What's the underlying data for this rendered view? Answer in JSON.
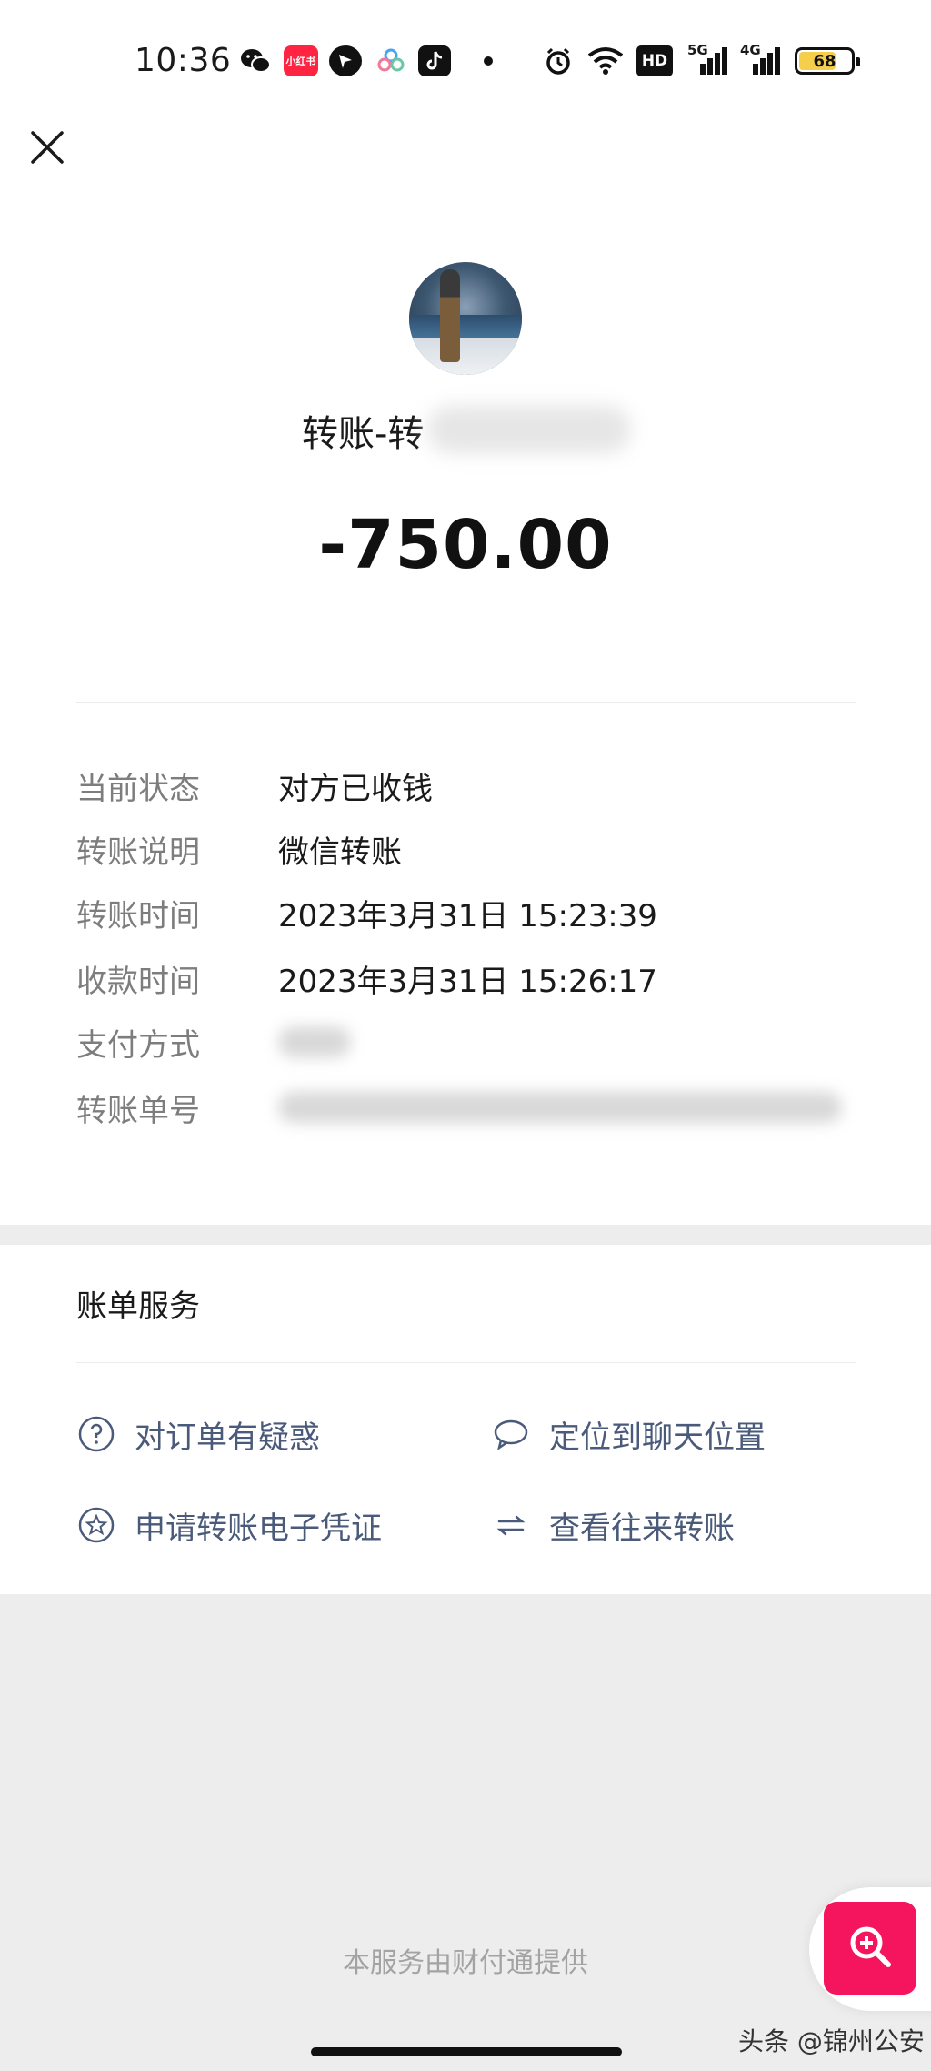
{
  "status_bar": {
    "time": "10:36",
    "app_xhs": "小红书",
    "hd": "HD",
    "signal_5g": "5G",
    "signal_4g": "4G",
    "battery": "68"
  },
  "header": {
    "title": "转账-转",
    "amount": "-750.00"
  },
  "details": {
    "status": {
      "label": "当前状态",
      "value": "对方已收钱"
    },
    "note": {
      "label": "转账说明",
      "value": "微信转账"
    },
    "transfer_time": {
      "label": "转账时间",
      "value": "2023年3月31日 15:23:39"
    },
    "receive_time": {
      "label": "收款时间",
      "value": "2023年3月31日 15:26:17"
    },
    "payment_method": {
      "label": "支付方式"
    },
    "order_number": {
      "label": "转账单号"
    }
  },
  "services": {
    "title": "账单服务",
    "question": "对订单有疑惑",
    "locate_chat": "定位到聊天位置",
    "voucher": "申请转账电子凭证",
    "history": "查看往来转账"
  },
  "footer": {
    "provider": "本服务由财付通提供",
    "watermark": "头条 @锦州公安"
  },
  "colors": {
    "accent_pink": "#f5145e",
    "link_text": "#4a5a7a",
    "label_gray": "#7d7d7d"
  }
}
